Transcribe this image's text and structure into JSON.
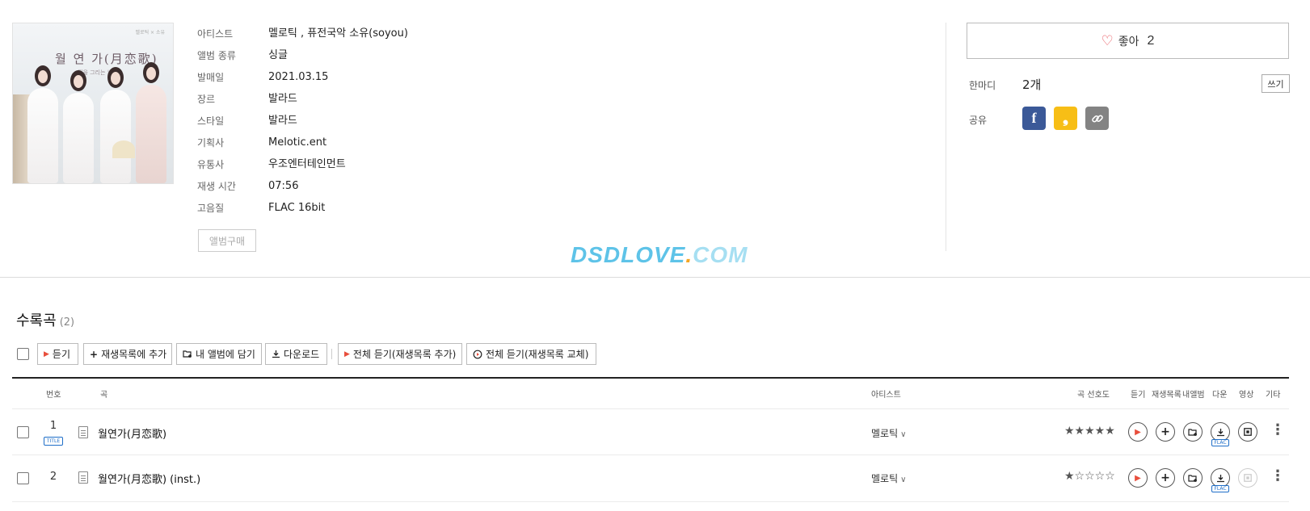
{
  "album": {
    "cover": {
      "title": "월 연 가(月恋歌)",
      "subtitle": "월을 그리는 노래",
      "corner": "멜로틱 × 소유"
    },
    "info": [
      {
        "key": "아티스트",
        "value": "멜로틱 , 퓨전국악 소유(soyou)"
      },
      {
        "key": "앨범 종류",
        "value": "싱글"
      },
      {
        "key": "발매일",
        "value": "2021.03.15"
      },
      {
        "key": "장르",
        "value": "발라드"
      },
      {
        "key": "스타일",
        "value": "발라드"
      },
      {
        "key": "기획사",
        "value": "Melotic.ent"
      },
      {
        "key": "유통사",
        "value": "우조엔터테인먼트"
      },
      {
        "key": "재생 시간",
        "value": "07:56"
      },
      {
        "key": "고음질",
        "value": "FLAC 16bit"
      }
    ],
    "buy_label": "앨범구매"
  },
  "watermark": {
    "part1": "DSDLOVE",
    "part2": ".",
    "part3": "COM"
  },
  "side": {
    "like_label": "좋아",
    "like_count": "2",
    "comment_label": "한마디",
    "comment_count": "2개",
    "write_label": "쓰기",
    "share_label": "공유",
    "share_buttons": [
      {
        "name": "facebook",
        "glyph": "f",
        "color": "#3b5998"
      },
      {
        "name": "kakao",
        "glyph": "❟",
        "color": "#f7be16"
      },
      {
        "name": "link",
        "glyph": "🔗",
        "color": "#838383"
      }
    ]
  },
  "tracks_section": {
    "title": "수록곡",
    "count": "(2)",
    "toolbar": {
      "listen": "듣기",
      "add_playlist": "재생목록에 추가",
      "add_album": "내 앨범에 담기",
      "download": "다운로드",
      "play_all_add": "전체 듣기(재생목록 추가)",
      "play_all_replace": "전체 듣기(재생목록 교체)"
    },
    "headers": {
      "no": "번호",
      "song": "곡",
      "artist": "아티스트",
      "rating": "곡 선호도",
      "listen": "듣기",
      "playlist": "재생목록",
      "my_album": "내앨범",
      "download": "다운",
      "video": "영상",
      "etc": "기타"
    },
    "rows": [
      {
        "no": "1",
        "badge": "TITLE",
        "title": "월연가(月恋歌)",
        "artist": "멜로틱",
        "stars": "★★★★★",
        "flac": "FLAC",
        "video_available": true
      },
      {
        "no": "2",
        "badge": "",
        "title": "월연가(月恋歌) (inst.)",
        "artist": "멜로틱",
        "stars": "★☆☆☆☆",
        "flac": "FLAC",
        "video_available": false
      }
    ]
  },
  "colors": {
    "accent_red": "#e84e3c",
    "badge_blue": "#1e6ec8",
    "facebook": "#3b5998",
    "kakao": "#f7be16"
  },
  "icons": {
    "heart": "heart-icon",
    "play": "play-icon",
    "plus": "plus-icon",
    "folder_add": "folder-add-icon",
    "download": "download-icon",
    "video": "video-icon",
    "more": "more-vertical-icon",
    "lyrics": "lyrics-icon",
    "chevron": "chevron-down-icon"
  }
}
